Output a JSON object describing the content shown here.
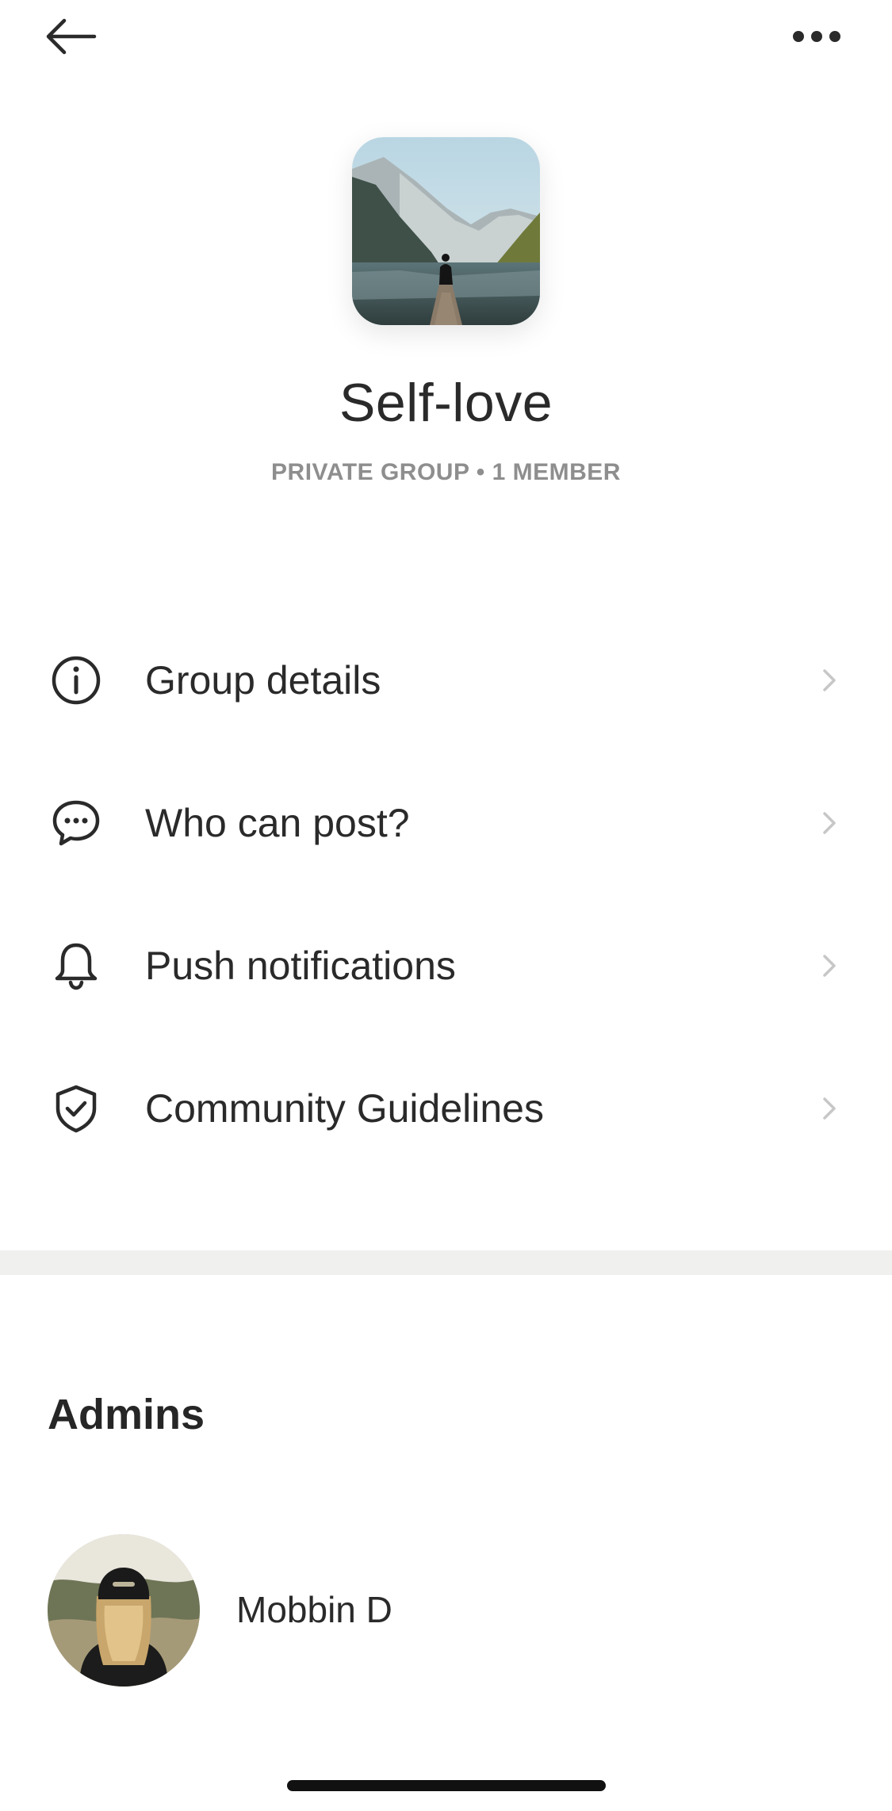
{
  "header": {
    "back_icon": "arrow-left-icon",
    "more_icon": "more-horizontal-icon"
  },
  "group": {
    "cover_image": "lake-dock-mountains-photo",
    "title": "Self-love",
    "meta": "PRIVATE GROUP • 1 MEMBER"
  },
  "menu": {
    "items": [
      {
        "label": "Group details",
        "icon": "info-circle-icon"
      },
      {
        "label": "Who can post?",
        "icon": "chat-bubble-icon"
      },
      {
        "label": "Push notifications",
        "icon": "bell-icon"
      },
      {
        "label": "Community Guidelines",
        "icon": "shield-check-icon"
      }
    ],
    "chevron_icon": "chevron-right-icon"
  },
  "admins": {
    "heading": "Admins",
    "items": [
      {
        "name": "Mobbin D",
        "avatar": "user-photo-avatar"
      }
    ]
  },
  "colors": {
    "text_primary": "#2a2a2a",
    "text_secondary": "#8e8e8e",
    "chevron": "#c7c7c7",
    "divider": "#f0f0ef",
    "home_indicator": "#111111"
  }
}
